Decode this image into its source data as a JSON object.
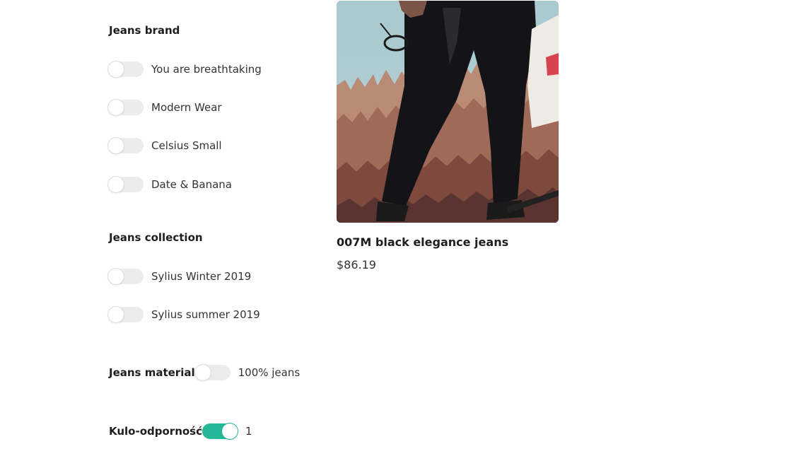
{
  "filters": {
    "brand": {
      "heading": "Jeans brand",
      "options": [
        {
          "label": "You are breathtaking",
          "checked": false
        },
        {
          "label": "Modern Wear",
          "checked": false
        },
        {
          "label": "Celsius Small",
          "checked": false
        },
        {
          "label": "Date & Banana",
          "checked": false
        }
      ]
    },
    "collection": {
      "heading": "Jeans collection",
      "options": [
        {
          "label": "Sylius Winter 2019",
          "checked": false
        },
        {
          "label": "Sylius summer 2019",
          "checked": false
        }
      ]
    },
    "material": {
      "heading": "Jeans material",
      "option": {
        "label": "100% jeans",
        "checked": false
      }
    },
    "bulletproof": {
      "heading": "Kulo-odporność",
      "option": {
        "label": "1",
        "checked": true
      }
    }
  },
  "product": {
    "name": "007M black elegance jeans",
    "price": "$86.19"
  },
  "colors": {
    "toggle_on": "#24b899",
    "toggle_off": "#ececec"
  }
}
